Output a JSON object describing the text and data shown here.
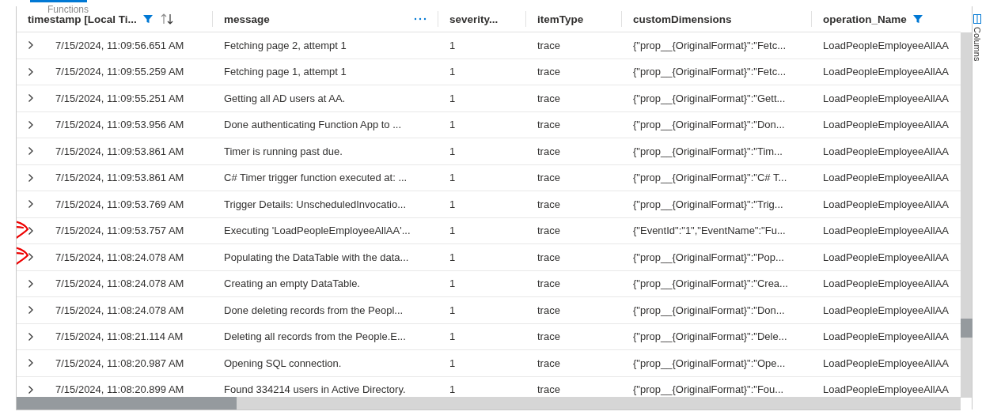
{
  "tab": {
    "label": "Functions",
    "selected": true
  },
  "columns": [
    {
      "label": "timestamp [Local Ti...",
      "filter": true,
      "sort": true,
      "more": false
    },
    {
      "label": "message",
      "filter": false,
      "sort": false,
      "more": true
    },
    {
      "label": "severity...",
      "filter": false,
      "sort": false,
      "more": false
    },
    {
      "label": "itemType",
      "filter": false,
      "sort": false,
      "more": false
    },
    {
      "label": "customDimensions",
      "filter": false,
      "sort": false,
      "more": false
    },
    {
      "label": "operation_Name",
      "filter": true,
      "sort": false,
      "more": false
    }
  ],
  "rows": [
    {
      "annotated": false,
      "cells": [
        "7/15/2024, 11:09:56.651 AM",
        "Fetching page 2, attempt 1",
        "1",
        "trace",
        "{\"prop__{OriginalFormat}\":\"Fetc...",
        "LoadPeopleEmployeeAllAA"
      ]
    },
    {
      "annotated": false,
      "cells": [
        "7/15/2024, 11:09:55.259 AM",
        "Fetching page 1, attempt 1",
        "1",
        "trace",
        "{\"prop__{OriginalFormat}\":\"Fetc...",
        "LoadPeopleEmployeeAllAA"
      ]
    },
    {
      "annotated": false,
      "cells": [
        "7/15/2024, 11:09:55.251 AM",
        "Getting all AD users at AA.",
        "1",
        "trace",
        "{\"prop__{OriginalFormat}\":\"Gett...",
        "LoadPeopleEmployeeAllAA"
      ]
    },
    {
      "annotated": false,
      "cells": [
        "7/15/2024, 11:09:53.956 AM",
        "Done authenticating Function App to ...",
        "1",
        "trace",
        "{\"prop__{OriginalFormat}\":\"Don...",
        "LoadPeopleEmployeeAllAA"
      ]
    },
    {
      "annotated": false,
      "cells": [
        "7/15/2024, 11:09:53.861 AM",
        "Timer is running past due.",
        "1",
        "trace",
        "{\"prop__{OriginalFormat}\":\"Tim...",
        "LoadPeopleEmployeeAllAA"
      ]
    },
    {
      "annotated": false,
      "cells": [
        "7/15/2024, 11:09:53.861 AM",
        "C# Timer trigger function executed at: ...",
        "1",
        "trace",
        "{\"prop__{OriginalFormat}\":\"C# T...",
        "LoadPeopleEmployeeAllAA"
      ]
    },
    {
      "annotated": false,
      "cells": [
        "7/15/2024, 11:09:53.769 AM",
        "Trigger Details: UnscheduledInvocatio...",
        "1",
        "trace",
        "{\"prop__{OriginalFormat}\":\"Trig...",
        "LoadPeopleEmployeeAllAA"
      ]
    },
    {
      "annotated": true,
      "cells": [
        "7/15/2024, 11:09:53.757 AM",
        "Executing 'LoadPeopleEmployeeAllAA'...",
        "1",
        "trace",
        "{\"EventId\":\"1\",\"EventName\":\"Fu...",
        "LoadPeopleEmployeeAllAA"
      ]
    },
    {
      "annotated": true,
      "cells": [
        "7/15/2024, 11:08:24.078 AM",
        "Populating the DataTable with the data...",
        "1",
        "trace",
        "{\"prop__{OriginalFormat}\":\"Pop...",
        "LoadPeopleEmployeeAllAA"
      ]
    },
    {
      "annotated": false,
      "cells": [
        "7/15/2024, 11:08:24.078 AM",
        "Creating an empty DataTable.",
        "1",
        "trace",
        "{\"prop__{OriginalFormat}\":\"Crea...",
        "LoadPeopleEmployeeAllAA"
      ]
    },
    {
      "annotated": false,
      "cells": [
        "7/15/2024, 11:08:24.078 AM",
        "Done deleting records from the Peopl...",
        "1",
        "trace",
        "{\"prop__{OriginalFormat}\":\"Don...",
        "LoadPeopleEmployeeAllAA"
      ]
    },
    {
      "annotated": false,
      "cells": [
        "7/15/2024, 11:08:21.114 AM",
        "Deleting all records from the People.E...",
        "1",
        "trace",
        "{\"prop__{OriginalFormat}\":\"Dele...",
        "LoadPeopleEmployeeAllAA"
      ]
    },
    {
      "annotated": false,
      "cells": [
        "7/15/2024, 11:08:20.987 AM",
        "Opening SQL connection.",
        "1",
        "trace",
        "{\"prop__{OriginalFormat}\":\"Ope...",
        "LoadPeopleEmployeeAllAA"
      ]
    },
    {
      "annotated": false,
      "cells": [
        "7/15/2024, 11:08:20.899 AM",
        "Found 334214 users in Active Directory.",
        "1",
        "trace",
        "{\"prop__{OriginalFormat}\":\"Fou...",
        "LoadPeopleEmployeeAllAA"
      ]
    }
  ],
  "side_panel": {
    "label": "Columns"
  }
}
